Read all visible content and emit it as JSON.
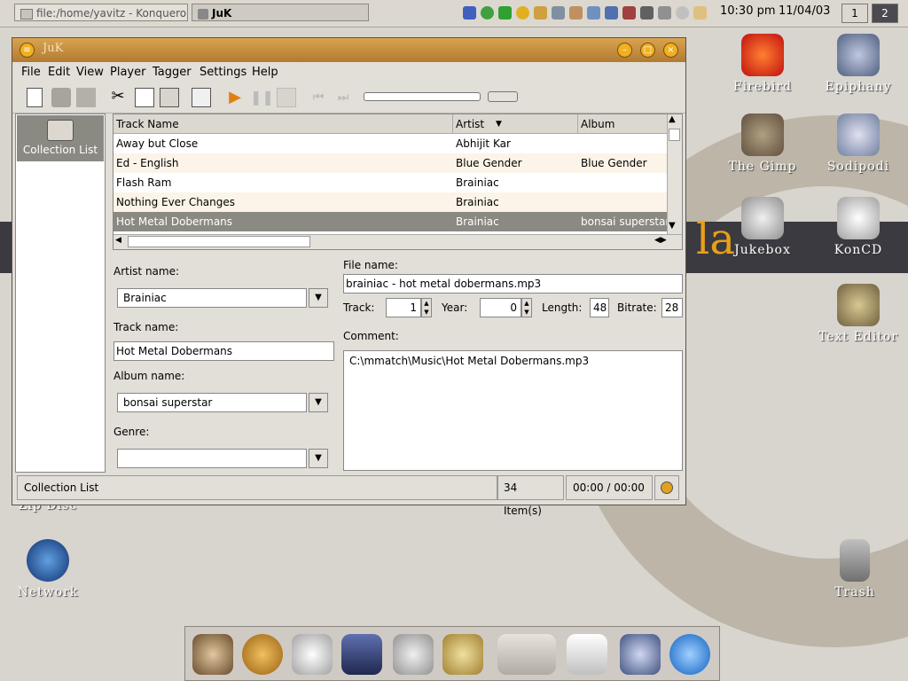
{
  "taskbar": {
    "tasks": [
      {
        "label": "file:/home/yavitz - Konqueror"
      },
      {
        "label": "JuK"
      }
    ],
    "clock": {
      "time": "10:30 pm",
      "date": "11/04/03"
    },
    "desktops": [
      "1",
      "2"
    ]
  },
  "desktop_icons": [
    {
      "label": "Firebird",
      "color": "#e02010"
    },
    {
      "label": "Epiphany",
      "color": "#7080a0"
    },
    {
      "label": "The Gimp",
      "color": "#807060"
    },
    {
      "label": "Sodipodi",
      "color": "#9090a0"
    },
    {
      "label": "Jukebox",
      "color": "#a0a0a0"
    },
    {
      "label": "KonCD",
      "color": "#b0b0b0"
    },
    {
      "label": "Text Editor",
      "color": "#808060"
    },
    {
      "label": "Zip Disc",
      "color": "#606070"
    },
    {
      "label": "Network",
      "color": "#2050a0"
    },
    {
      "label": "Trash",
      "color": "#909090"
    }
  ],
  "wallpaper_text": "la",
  "window": {
    "title": "JuK",
    "menu": [
      "File",
      "Edit",
      "View",
      "Player",
      "Tagger",
      "Settings",
      "Help"
    ],
    "menu_underline": [
      "F",
      "E",
      "V",
      "P",
      "T",
      "S",
      "H"
    ],
    "sidebar": {
      "item": "Collection List"
    },
    "playlist": {
      "columns": [
        "Track Name",
        "Artist",
        "Album"
      ],
      "rows": [
        {
          "track": "Away but Close",
          "artist": "Abhijit Kar",
          "album": ""
        },
        {
          "track": "Ed - English",
          "artist": "Blue Gender",
          "album": "Blue Gender"
        },
        {
          "track": "Flash Ram",
          "artist": "Brainiac",
          "album": ""
        },
        {
          "track": "Nothing Ever Changes",
          "artist": "Brainiac",
          "album": ""
        },
        {
          "track": "Hot Metal Dobermans",
          "artist": "Brainiac",
          "album": "bonsai superstar"
        }
      ]
    },
    "tag_editor": {
      "artist_label": "Artist name:",
      "artist_value": "Brainiac",
      "track_label": "Track name:",
      "track_value": "Hot Metal Dobermans",
      "album_label": "Album name:",
      "album_value": "bonsai superstar",
      "genre_label": "Genre:",
      "genre_value": "",
      "file_label": "File name:",
      "file_value": "brainiac - hot metal dobermans.mp3",
      "tracknum_label": "Track:",
      "tracknum_value": "1",
      "year_label": "Year:",
      "year_value": "0",
      "length_label": "Length:",
      "length_value": "48",
      "bitrate_label": "Bitrate:",
      "bitrate_value": "28",
      "comment_label": "Comment:",
      "comment_value": "C:\\mmatch\\Music\\Hot Metal Dobermans.mp3"
    },
    "status": {
      "playlist": "Collection List",
      "count": "34 Item(s)",
      "time": "00:00 / 00:00"
    }
  },
  "dock_icons": [
    "monkey-icon",
    "spider-icon",
    "mail-icon",
    "terminal-icon",
    "tools-icon",
    "paint-icon",
    "clipboard-icon",
    "window-icon",
    "gnome-foot-icon",
    "ximian-icon"
  ]
}
